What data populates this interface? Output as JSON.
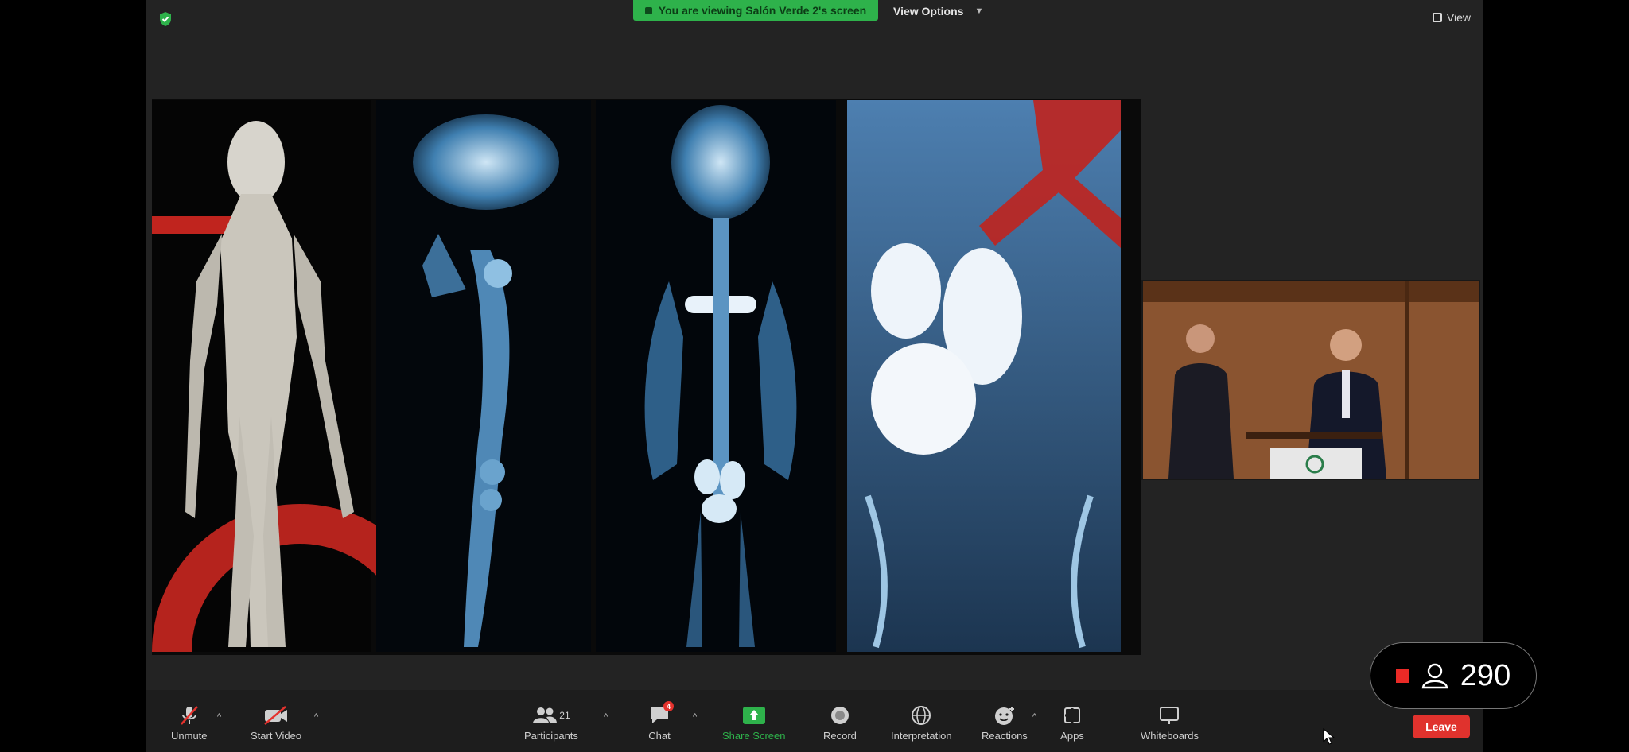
{
  "header": {
    "share_banner": "You are viewing Salón Verde 2's screen",
    "view_options": "View Options",
    "view_label": "View"
  },
  "toolbar": {
    "unmute": "Unmute",
    "start_video": "Start Video",
    "participants": "Participants",
    "participants_count": "21",
    "chat": "Chat",
    "chat_badge": "4",
    "share_screen": "Share Screen",
    "record": "Record",
    "interpretation": "Interpretation",
    "reactions": "Reactions",
    "apps": "Apps",
    "whiteboards": "Whiteboards",
    "leave": "Leave"
  },
  "live": {
    "viewer_count": "290"
  },
  "colors": {
    "share_green": "#2eb24b",
    "leave_red": "#e0322d",
    "window_bg": "#232323",
    "accent_red": "#c0241e"
  }
}
